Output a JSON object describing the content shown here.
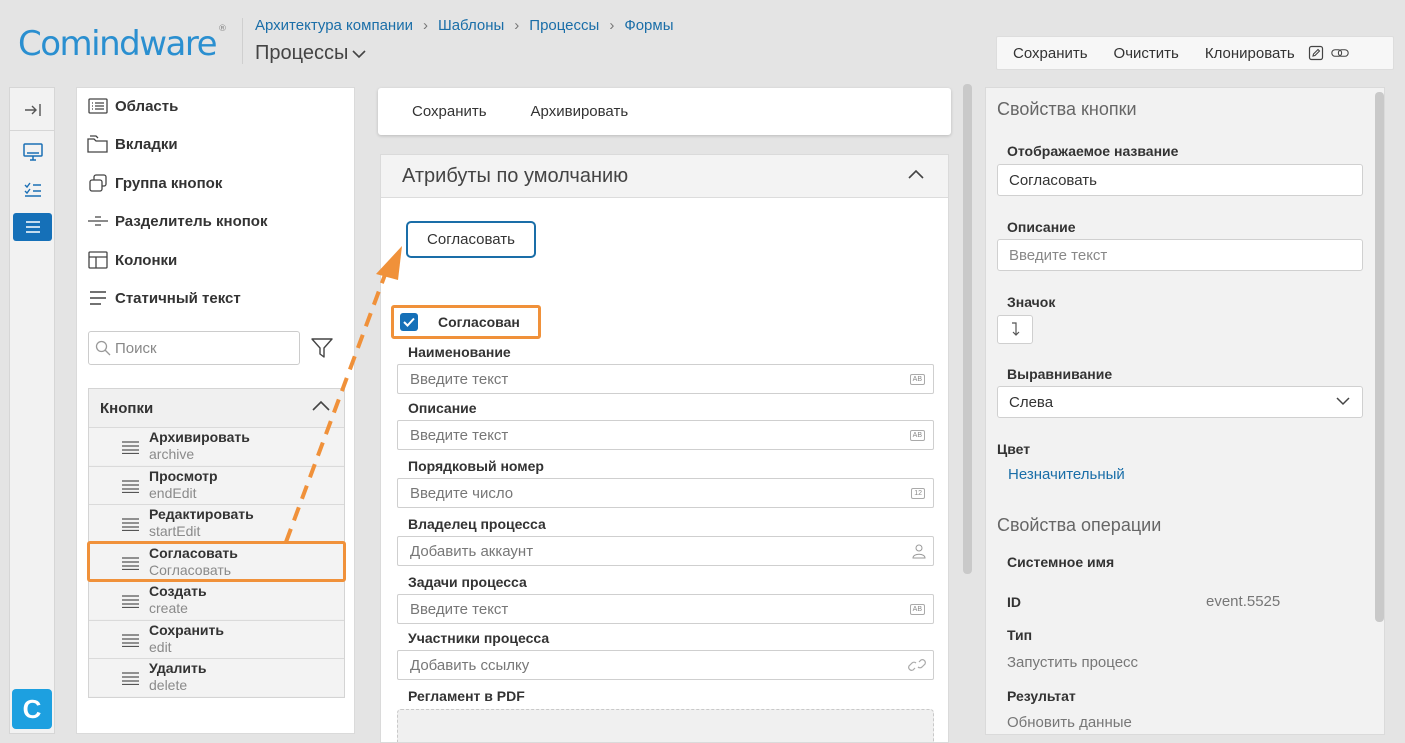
{
  "header": {
    "logo": "Comindware",
    "logo_mark": "®",
    "breadcrumbs": [
      "Архитектура компании",
      "Шаблоны",
      "Процессы",
      "Формы"
    ],
    "page_title": "Процессы",
    "toolbar": {
      "save": "Сохранить",
      "clear": "Очистить",
      "clone": "Клонировать"
    }
  },
  "rail": {
    "logo_letter": "C"
  },
  "components": {
    "items": [
      {
        "label": "Область",
        "icon": "list-icon"
      },
      {
        "label": "Вкладки",
        "icon": "tabs-icon"
      },
      {
        "label": "Группа кнопок",
        "icon": "button-group-icon"
      },
      {
        "label": "Разделитель кнопок",
        "icon": "divider-icon"
      },
      {
        "label": "Колонки",
        "icon": "columns-icon"
      },
      {
        "label": "Статичный текст",
        "icon": "text-icon"
      }
    ],
    "search_placeholder": "Поиск",
    "buttons_title": "Кнопки",
    "buttons": [
      {
        "name": "Архивировать",
        "alias": "archive"
      },
      {
        "name": "Просмотр",
        "alias": "endEdit"
      },
      {
        "name": "Редактировать",
        "alias": "startEdit"
      },
      {
        "name": "Согласовать",
        "alias": "Согласовать"
      },
      {
        "name": "Создать",
        "alias": "create"
      },
      {
        "name": "Сохранить",
        "alias": "edit"
      },
      {
        "name": "Удалить",
        "alias": "delete"
      }
    ]
  },
  "form": {
    "toolbar": {
      "save": "Сохранить",
      "archive": "Архивировать"
    },
    "section_title": "Атрибуты по умолчанию",
    "approve_button": "Согласовать",
    "checkbox_label": "Согласован",
    "fields": [
      {
        "label": "Наименование",
        "placeholder": "Введите текст",
        "icon": "text-field-icon",
        "tag": "AB"
      },
      {
        "label": "Описание",
        "placeholder": "Введите текст",
        "icon": "text-field-icon",
        "tag": "AB"
      },
      {
        "label": "Порядковый номер",
        "placeholder": "Введите число",
        "icon": "number-field-icon",
        "tag": "12"
      },
      {
        "label": "Владелец процесса",
        "placeholder": "Добавить аккаунт",
        "icon": "user-icon"
      },
      {
        "label": "Задачи процесса",
        "placeholder": "Введите текст",
        "icon": "text-field-icon",
        "tag": "AB"
      },
      {
        "label": "Участники процесса",
        "placeholder": "Добавить ссылку",
        "icon": "link-icon"
      }
    ],
    "pdf_label": "Регламент в PDF"
  },
  "properties": {
    "button_section": "Свойства кнопки",
    "display_name_label": "Отображаемое название",
    "display_name_value": "Согласовать",
    "description_label": "Описание",
    "description_placeholder": "Введите текст",
    "icon_label": "Значок",
    "align_label": "Выравнивание",
    "align_value": "Слева",
    "color_label": "Цвет",
    "color_value": "Незначительный",
    "operation_section": "Свойства операции",
    "system_name_label": "Системное имя",
    "id_label": "ID",
    "id_value": "event.5525",
    "type_label": "Тип",
    "type_value": "Запустить процесс",
    "result_label": "Результат",
    "result_value": "Обновить данные"
  },
  "colors": {
    "accent": "#1570b8",
    "highlight": "#f0913a",
    "link": "#1a6ea8"
  }
}
